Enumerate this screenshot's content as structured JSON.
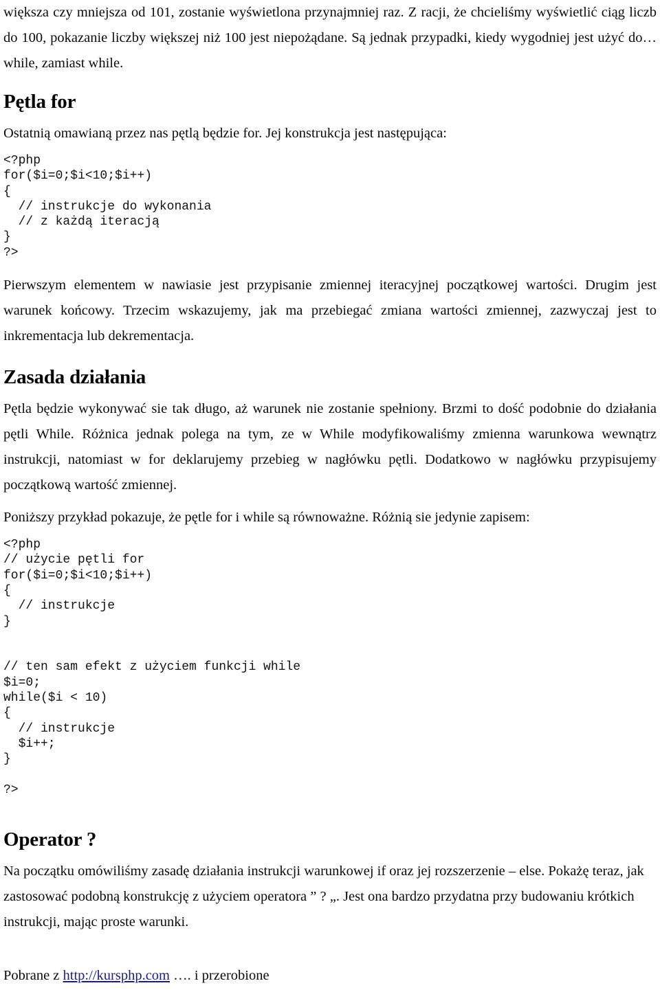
{
  "document": {
    "intro_paragraph": "większa czy mniejsza od 101, zostanie wyświetlona przynajmniej raz. Z racji, że chcieliśmy wyświetlić ciąg liczb do 100, pokazanie liczby większej niż 100 jest niepożądane. Są jednak przypadki, kiedy wygodniej jest użyć do… while, zamiast while.",
    "section_for": {
      "heading": "Pętla for",
      "intro": "Ostatnią omawianą przez nas pętlą będzie for. Jej konstrukcja jest następująca:",
      "code": "<?php\nfor($i=0;$i<10;$i++)\n{\n  // instrukcje do wykonania\n  // z każdą iteracją\n}\n?>",
      "explanation": "Pierwszym elementem w nawiasie jest przypisanie zmiennej iteracyjnej początkowej wartości. Drugim jest warunek końcowy. Trzecim wskazujemy, jak ma przebiegać zmiana wartości zmiennej, zazwyczaj jest to inkrementacja lub dekrementacja."
    },
    "section_principle": {
      "heading": "Zasada działania",
      "paragraph_1": "Pętla będzie wykonywać sie tak długo, aż warunek nie zostanie spełniony. Brzmi to dość podobnie do działania pętli While. Różnica jednak polega na tym, ze w While modyfikowaliśmy zmienna warunkowa wewnątrz instrukcji, natomiast w for deklarujemy przebieg w nagłówku pętli. Dodatkowo w nagłówku przypisujemy początkową wartość zmiennej.",
      "paragraph_2": "Poniższy przykład pokazuje, że pętle for i while są równoważne. Różnią sie jedynie zapisem:",
      "code": "<?php\n// użycie pętli for\nfor($i=0;$i<10;$i++)\n{\n  // instrukcje\n}\n\n\n// ten sam efekt z użyciem funkcji while\n$i=0;\nwhile($i < 10)\n{\n  // instrukcje\n  $i++;\n}\n\n?>"
    },
    "section_operator": {
      "heading": "Operator ?",
      "paragraph": "Na początku omówiliśmy zasadę działania instrukcji warunkowej if oraz jej rozszerzenie – else. Pokażę teraz, jak zastosować podobną konstrukcję z użyciem operatora ” ? „. Jest ona bardzo przydatna przy budowaniu krótkich instrukcji, mając proste warunki."
    },
    "footer": {
      "prefix": "Pobrane z ",
      "link_text": "http://kursphp.com",
      "suffix": " …. i przerobione",
      "link_color": "#1b1b8f"
    }
  }
}
